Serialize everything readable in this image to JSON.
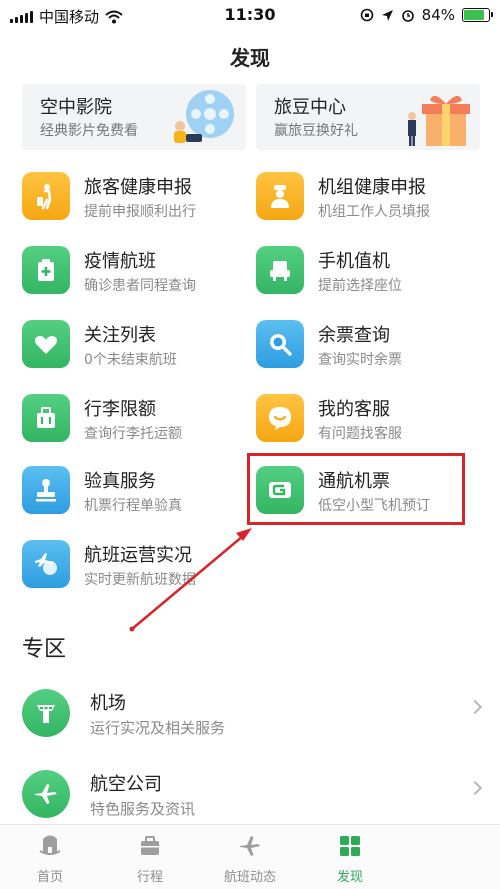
{
  "status_bar": {
    "carrier": "中国移动",
    "time": "11:30",
    "battery": "84%",
    "battery_level": 0.84
  },
  "page": {
    "title": "发现"
  },
  "promos": [
    {
      "title": "空中影院",
      "subtitle": "经典影片免费看",
      "icon": "film-reel-illustration"
    },
    {
      "title": "旅豆中心",
      "subtitle": "赢旅豆换好礼",
      "icon": "gift-box-illustration"
    }
  ],
  "functions": [
    {
      "title": "旅客健康申报",
      "subtitle": "提前申报顺利出行",
      "icon": "traveler-icon",
      "color": "#f6a712"
    },
    {
      "title": "机组健康申报",
      "subtitle": "机组工作人员填报",
      "icon": "pilot-icon",
      "color": "#f6a712"
    },
    {
      "title": "疫情航班",
      "subtitle": "确诊患者同程查询",
      "icon": "medical-kit-icon",
      "color": "#33b563"
    },
    {
      "title": "手机值机",
      "subtitle": "提前选择座位",
      "icon": "seat-icon",
      "color": "#33b563"
    },
    {
      "title": "关注列表",
      "subtitle": "0个未结束航班",
      "icon": "heart-icon",
      "color": "#33b563"
    },
    {
      "title": "余票查询",
      "subtitle": "查询实时余票",
      "icon": "magnifier-icon",
      "color": "#2e9de0"
    },
    {
      "title": "行李限额",
      "subtitle": "查询行李托运额",
      "icon": "luggage-icon",
      "color": "#33b563"
    },
    {
      "title": "我的客服",
      "subtitle": "有问题找客服",
      "icon": "chat-bubble-icon",
      "color": "#f6a712"
    },
    {
      "title": "验真服务",
      "subtitle": "机票行程单验真",
      "icon": "stamp-icon",
      "color": "#2e9de0"
    },
    {
      "title": "通航机票",
      "subtitle": "低空小型飞机预订",
      "icon": "g-letter-icon",
      "color": "#33b563"
    },
    {
      "title": "航班运营实况",
      "subtitle": "实时更新航班数据",
      "icon": "plane-globe-icon",
      "color": "#2e9de0"
    }
  ],
  "zone": {
    "title": "专区",
    "items": [
      {
        "title": "机场",
        "subtitle": "运行实况及相关服务",
        "icon": "airport-tower-icon"
      },
      {
        "title": "航空公司",
        "subtitle": "特色服务及资讯",
        "icon": "airplane-icon"
      }
    ]
  },
  "tabbar": {
    "tabs": [
      {
        "label": "首页",
        "icon": "home-icon",
        "active": false
      },
      {
        "label": "行程",
        "icon": "briefcase-icon",
        "active": false
      },
      {
        "label": "航班动态",
        "icon": "airplane-tab-icon",
        "active": false
      },
      {
        "label": "发现",
        "icon": "grid-icon",
        "active": true
      }
    ]
  },
  "colors": {
    "accent_green": "#2faa58",
    "highlight_red": "#d7262b"
  }
}
